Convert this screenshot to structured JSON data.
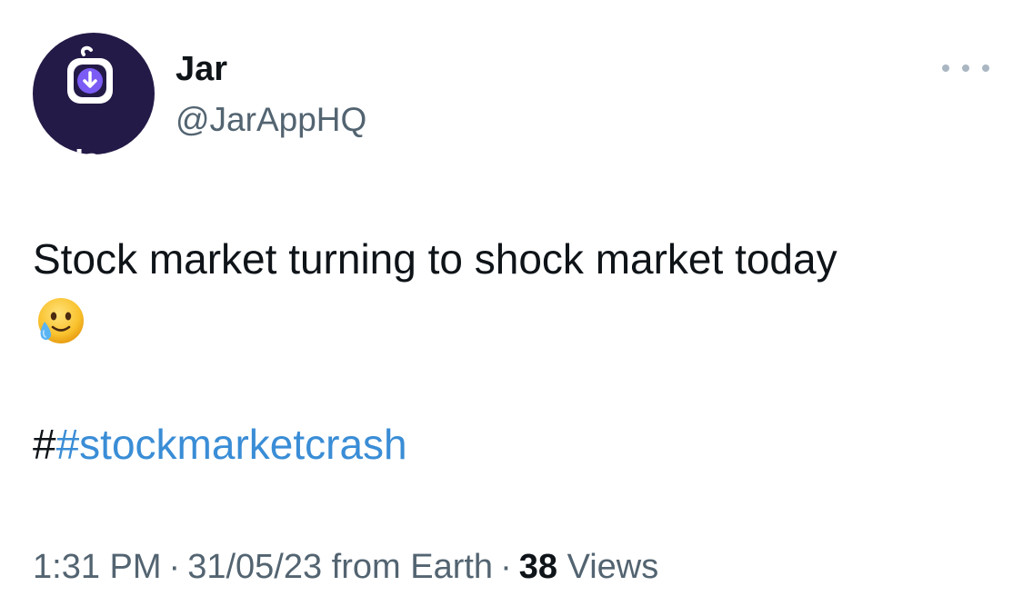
{
  "author": {
    "display_name": "Jar",
    "handle": "@JarAppHQ",
    "avatar_label": "Jar",
    "avatar_colors": {
      "background": "#241a47",
      "badge_outer": "#ffffff",
      "badge_inner": "#7b5cf5",
      "arrow": "#ffffff"
    }
  },
  "menu": {
    "icon": "more-horizontal-icon"
  },
  "tweet": {
    "text": "Stock market turning to shock market today",
    "emoji_icon": "face-holding-back-tears-icon",
    "hashtag_prefix": "#",
    "hashtag": "#stockmarketcrash",
    "hashtag_color": "#3a8dd6"
  },
  "meta": {
    "time": "1:31 PM",
    "separator": "·",
    "date": "31/05/23",
    "source": "from Earth",
    "views_count": "38",
    "views_label": "Views"
  }
}
